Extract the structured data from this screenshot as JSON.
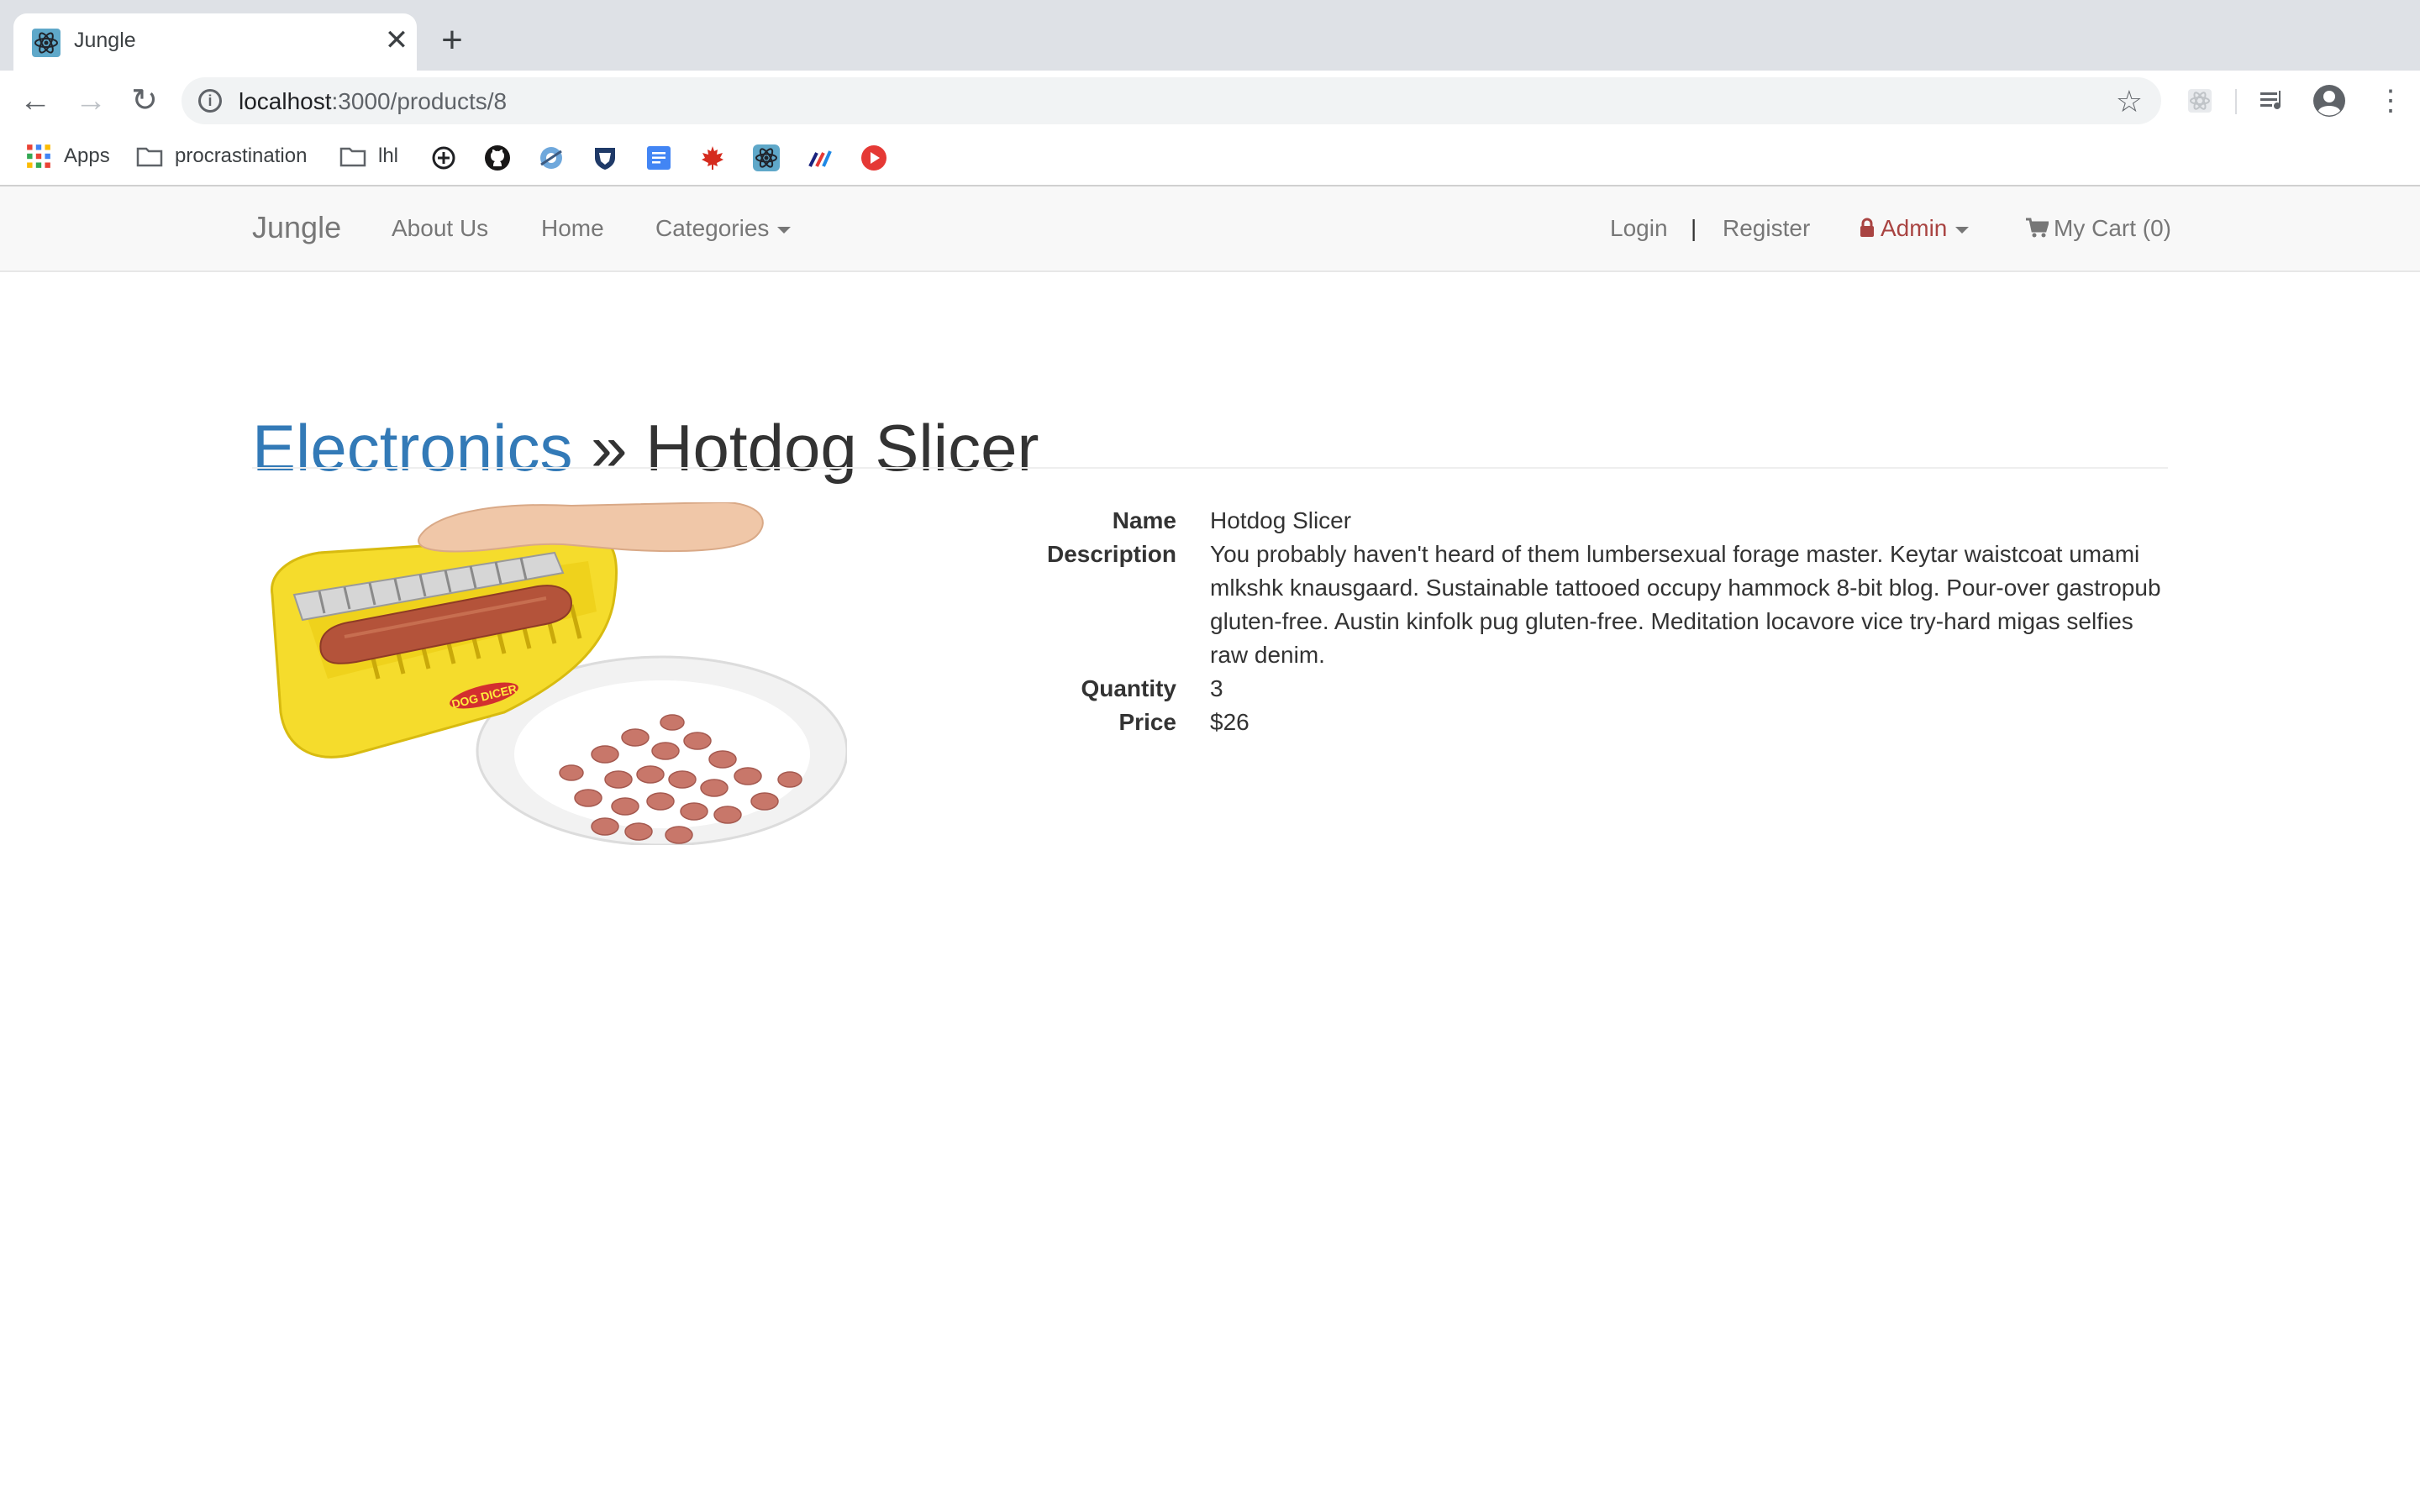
{
  "browser": {
    "tab_title": "Jungle",
    "tab_close": "✕",
    "new_tab": "+",
    "url_host": "localhost",
    "url_path": ":3000/products/8",
    "bookmarks": [
      {
        "label": "Apps",
        "icon": "apps-grid-icon"
      },
      {
        "label": "procrastination",
        "icon": "folder-icon"
      },
      {
        "label": "lhl",
        "icon": "folder-icon"
      }
    ],
    "bookmark_icons": [
      "target-icon",
      "github-icon",
      "blue-gear-icon",
      "shield-icon",
      "google-docs-icon",
      "maple-leaf-icon",
      "react-icon",
      "analytics-icon",
      "red-play-icon"
    ]
  },
  "navbar": {
    "brand": "Jungle",
    "about": "About Us",
    "home": "Home",
    "categories": "Categories",
    "login": "Login",
    "separator": "|",
    "register": "Register",
    "admin": "Admin",
    "cart": "My Cart (0)"
  },
  "product": {
    "category": "Electronics",
    "separator": "»",
    "title": "Hotdog Slicer",
    "fields": {
      "name_label": "Name",
      "name": "Hotdog Slicer",
      "description_label": "Description",
      "description": "You probably haven't heard of them lumbersexual forage master. Keytar waistcoat umami mlkshk knausgaard. Sustainable tattooed occupy hammock 8-bit blog. Pour-over gastropub gluten-free. Austin kinfolk pug gluten-free. Meditation locavore vice try-hard migas selfies raw denim.",
      "quantity_label": "Quantity",
      "quantity": "3",
      "price_label": "Price",
      "price": "$26"
    },
    "image_text": "DOG DICER"
  },
  "colors": {
    "link_blue": "#337ab7",
    "admin_red": "#a94442",
    "navbar_bg": "#f8f8f8",
    "tabstrip_bg": "#dee1e6"
  }
}
